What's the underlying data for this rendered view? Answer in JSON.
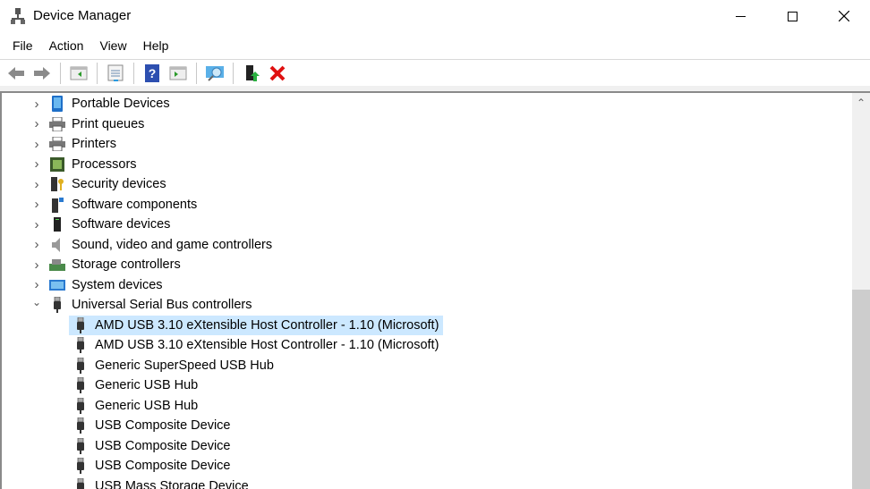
{
  "window": {
    "title": "Device Manager",
    "minimize": "—",
    "maximize": "☐",
    "close": "✕"
  },
  "menu": [
    "File",
    "Action",
    "View",
    "Help"
  ],
  "toolbar": [
    "back-icon",
    "forward-icon",
    "show-hide-console-tree-icon",
    "properties-icon",
    "help-icon",
    "show-action-pane-icon",
    "scan-hardware-icon",
    "update-driver-icon",
    "uninstall-device-icon"
  ],
  "tree": {
    "categories": [
      {
        "label": "Portable Devices",
        "icon": "portable-device-icon",
        "expanded": false
      },
      {
        "label": "Print queues",
        "icon": "printer-icon",
        "expanded": false
      },
      {
        "label": "Printers",
        "icon": "printer-icon",
        "expanded": false
      },
      {
        "label": "Processors",
        "icon": "processor-icon",
        "expanded": false
      },
      {
        "label": "Security devices",
        "icon": "security-device-icon",
        "expanded": false
      },
      {
        "label": "Software components",
        "icon": "software-component-icon",
        "expanded": false
      },
      {
        "label": "Software devices",
        "icon": "software-device-icon",
        "expanded": false
      },
      {
        "label": "Sound, video and game controllers",
        "icon": "speaker-icon",
        "expanded": false
      },
      {
        "label": "Storage controllers",
        "icon": "storage-controller-icon",
        "expanded": false
      },
      {
        "label": "System devices",
        "icon": "system-device-icon",
        "expanded": false
      },
      {
        "label": "Universal Serial Bus controllers",
        "icon": "usb-icon",
        "expanded": true
      }
    ],
    "usb_children": [
      {
        "label": "AMD USB 3.10 eXtensible Host Controller - 1.10 (Microsoft)",
        "selected": true
      },
      {
        "label": "AMD USB 3.10 eXtensible Host Controller - 1.10 (Microsoft)"
      },
      {
        "label": "Generic SuperSpeed USB Hub"
      },
      {
        "label": "Generic USB Hub"
      },
      {
        "label": "Generic USB Hub"
      },
      {
        "label": "USB Composite Device"
      },
      {
        "label": "USB Composite Device"
      },
      {
        "label": "USB Composite Device"
      },
      {
        "label": "USB Mass Storage Device"
      }
    ]
  },
  "scrollbar": {
    "position_fraction": 0.5,
    "up_arrow": "⌃"
  }
}
